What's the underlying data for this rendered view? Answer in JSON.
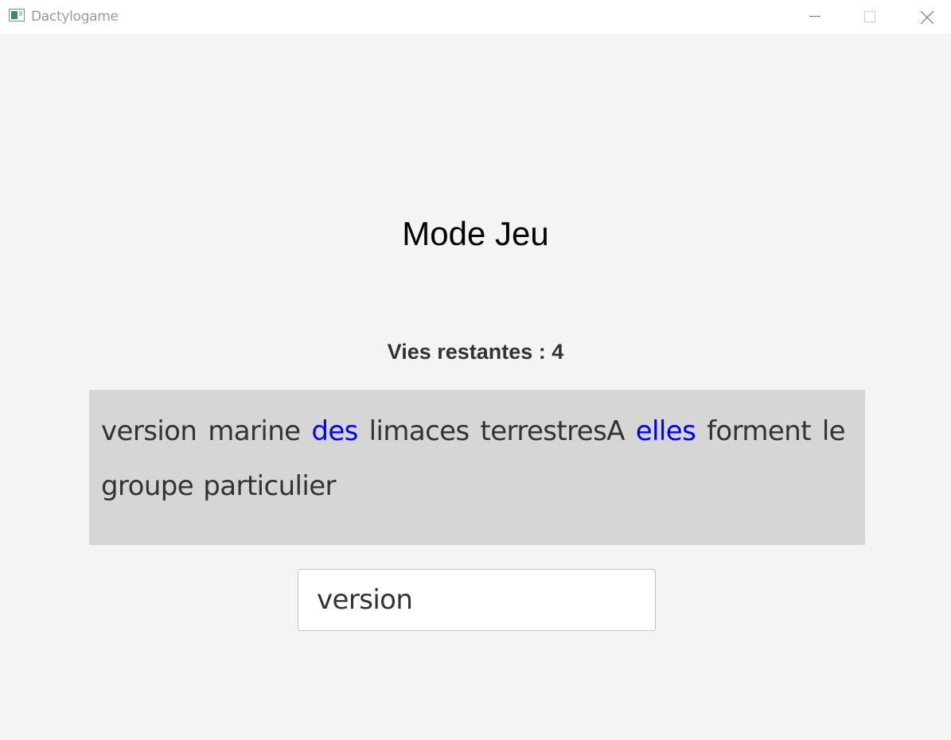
{
  "window": {
    "title": "Dactylogame",
    "icon": "app-window-icon",
    "controls": [
      "minimize-icon",
      "maximize-icon",
      "close-icon"
    ]
  },
  "game": {
    "heading": "Mode Jeu",
    "lives_text": "Vies restantes : 4",
    "words": [
      {
        "text": "version",
        "highlight": false
      },
      {
        "text": "marine",
        "highlight": false
      },
      {
        "text": "des",
        "highlight": true
      },
      {
        "text": "limaces",
        "highlight": false
      },
      {
        "text": "terrestresA",
        "highlight": false
      },
      {
        "text": "elles",
        "highlight": true
      },
      {
        "text": "forment",
        "highlight": false
      },
      {
        "text": "le",
        "highlight": false
      },
      {
        "text": "groupe",
        "highlight": false
      },
      {
        "text": "particulier",
        "highlight": false
      }
    ],
    "input_value": "version"
  },
  "colors": {
    "background": "#f4f4f4",
    "text_panel": "#d6d6d6",
    "word_default": "#333333",
    "word_highlight": "#0000ff"
  }
}
